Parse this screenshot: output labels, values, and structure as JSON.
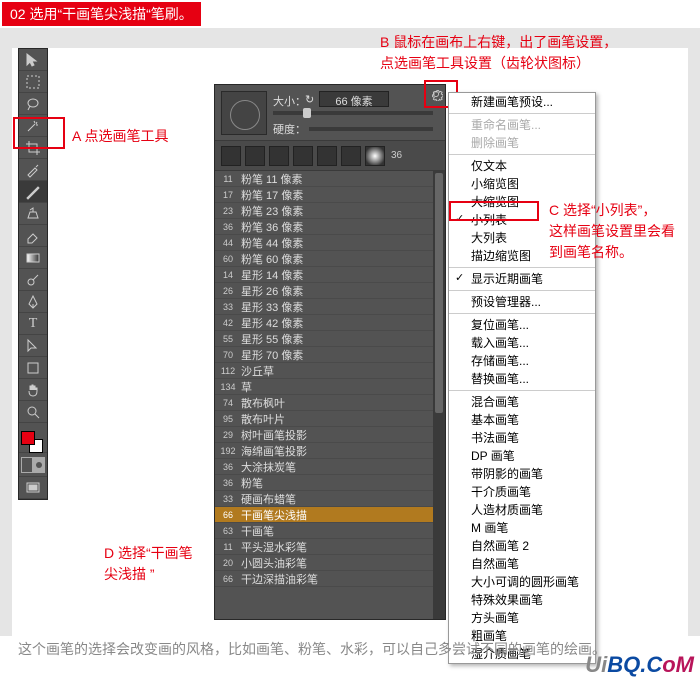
{
  "header": {
    "step": "02 选用“干画笔尖浅描“笔刷。"
  },
  "annotations": {
    "A": "A 点选画笔工具",
    "B": "B 鼠标在画布上右键，出了画笔设置，\n点选画笔工具设置（齿轮状图标）",
    "C": "C 选择“小列表”，\n这样画笔设置里会看\n到画笔名称。",
    "D": "D 选择“干画笔\n尖浅描 ”"
  },
  "panel": {
    "size_label": "大小：",
    "size_value": "66 像素",
    "hardness_label": "硬度：",
    "thumb_num": "36"
  },
  "brushes": [
    {
      "sw": "11",
      "name": "粉笔 11 像素"
    },
    {
      "sw": "17",
      "name": "粉笔 17 像素"
    },
    {
      "sw": "23",
      "name": "粉笔 23 像素"
    },
    {
      "sw": "36",
      "name": "粉笔 36 像素"
    },
    {
      "sw": "44",
      "name": "粉笔 44 像素"
    },
    {
      "sw": "60",
      "name": "粉笔 60 像素"
    },
    {
      "sw": "14",
      "name": "星形 14 像素"
    },
    {
      "sw": "26",
      "name": "星形 26 像素"
    },
    {
      "sw": "33",
      "name": "星形 33 像素"
    },
    {
      "sw": "42",
      "name": "星形 42 像素"
    },
    {
      "sw": "55",
      "name": "星形 55 像素"
    },
    {
      "sw": "70",
      "name": "星形 70 像素"
    },
    {
      "sw": "112",
      "name": "沙丘草"
    },
    {
      "sw": "134",
      "name": "草"
    },
    {
      "sw": "74",
      "name": "散布枫叶"
    },
    {
      "sw": "95",
      "name": "散布叶片"
    },
    {
      "sw": "29",
      "name": "树叶画笔投影"
    },
    {
      "sw": "192",
      "name": "海绵画笔投影"
    },
    {
      "sw": "36",
      "name": "大涂抹炭笔"
    },
    {
      "sw": "36",
      "name": "粉笔"
    },
    {
      "sw": "33",
      "name": "硬画布蜡笔"
    },
    {
      "sw": "66",
      "name": "干画笔尖浅描",
      "selected": true
    },
    {
      "sw": "63",
      "name": "干画笔"
    },
    {
      "sw": "11",
      "name": "平头湿水彩笔"
    },
    {
      "sw": "20",
      "name": "小圆头油彩笔"
    },
    {
      "sw": "66",
      "name": "干边深描油彩笔"
    }
  ],
  "menu": [
    {
      "type": "item",
      "label": "新建画笔预设...",
      "disabled": false
    },
    {
      "type": "sep"
    },
    {
      "type": "item",
      "label": "重命名画笔...",
      "disabled": true
    },
    {
      "type": "item",
      "label": "删除画笔",
      "disabled": true
    },
    {
      "type": "sep"
    },
    {
      "type": "item",
      "label": "仅文本"
    },
    {
      "type": "item",
      "label": "小缩览图"
    },
    {
      "type": "item",
      "label": "大缩览图"
    },
    {
      "type": "item",
      "label": "小列表",
      "checked": true,
      "boxed": true
    },
    {
      "type": "item",
      "label": "大列表"
    },
    {
      "type": "item",
      "label": "描边缩览图"
    },
    {
      "type": "sep"
    },
    {
      "type": "item",
      "label": "显示近期画笔",
      "checked": true
    },
    {
      "type": "sep"
    },
    {
      "type": "item",
      "label": "预设管理器..."
    },
    {
      "type": "sep"
    },
    {
      "type": "item",
      "label": "复位画笔..."
    },
    {
      "type": "item",
      "label": "载入画笔..."
    },
    {
      "type": "item",
      "label": "存储画笔..."
    },
    {
      "type": "item",
      "label": "替换画笔..."
    },
    {
      "type": "sep"
    },
    {
      "type": "item",
      "label": "混合画笔"
    },
    {
      "type": "item",
      "label": "基本画笔"
    },
    {
      "type": "item",
      "label": "书法画笔"
    },
    {
      "type": "item",
      "label": "DP 画笔"
    },
    {
      "type": "item",
      "label": "带阴影的画笔"
    },
    {
      "type": "item",
      "label": "干介质画笔"
    },
    {
      "type": "item",
      "label": "人造材质画笔"
    },
    {
      "type": "item",
      "label": "M 画笔"
    },
    {
      "type": "item",
      "label": "自然画笔 2"
    },
    {
      "type": "item",
      "label": "自然画笔"
    },
    {
      "type": "item",
      "label": "大小可调的圆形画笔"
    },
    {
      "type": "item",
      "label": "特殊效果画笔"
    },
    {
      "type": "item",
      "label": "方头画笔"
    },
    {
      "type": "item",
      "label": "粗画笔"
    },
    {
      "type": "item",
      "label": "湿介质画笔"
    }
  ],
  "footer": "这个画笔的选择会改变画的风格，比如画笔、粉笔、水彩，可以自己多尝试不同的画笔的绘画。",
  "watermark": {
    "a": "Ui",
    "b": "BQ",
    "c": ".C",
    "d": "oM"
  }
}
